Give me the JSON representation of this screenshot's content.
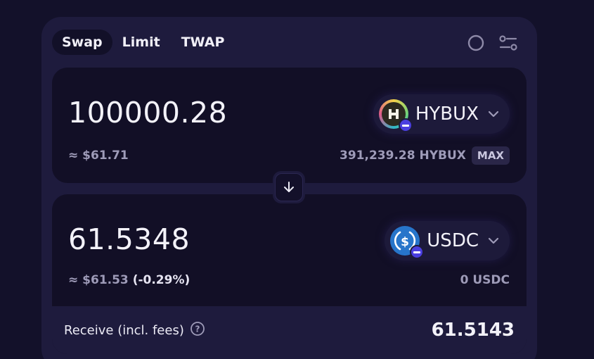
{
  "tabs": [
    {
      "label": "Swap",
      "active": true
    },
    {
      "label": "Limit",
      "active": false
    },
    {
      "label": "TWAP",
      "active": false
    }
  ],
  "top_icons": [
    "refresh-timer-icon",
    "settings-sliders-icon"
  ],
  "from": {
    "amount": "100000.28",
    "usd_value": "≈ $61.71",
    "token_symbol": "HYBUX",
    "balance": "391,239.28 HYBUX",
    "max_label": "MAX"
  },
  "to": {
    "amount": "61.5348",
    "usd_value": "≈ $61.53",
    "usd_change": "(-0.29%)",
    "token_symbol": "USDC",
    "balance": "0 USDC"
  },
  "receive": {
    "label": "Receive (incl. fees)",
    "value": "61.5143"
  },
  "colors": {
    "page_bg": "#13112a",
    "card_bg": "#1e1b3d",
    "panel_bg": "#120f26",
    "usdc_blue": "#2775ca",
    "badge_purple": "#4b3fe0"
  }
}
